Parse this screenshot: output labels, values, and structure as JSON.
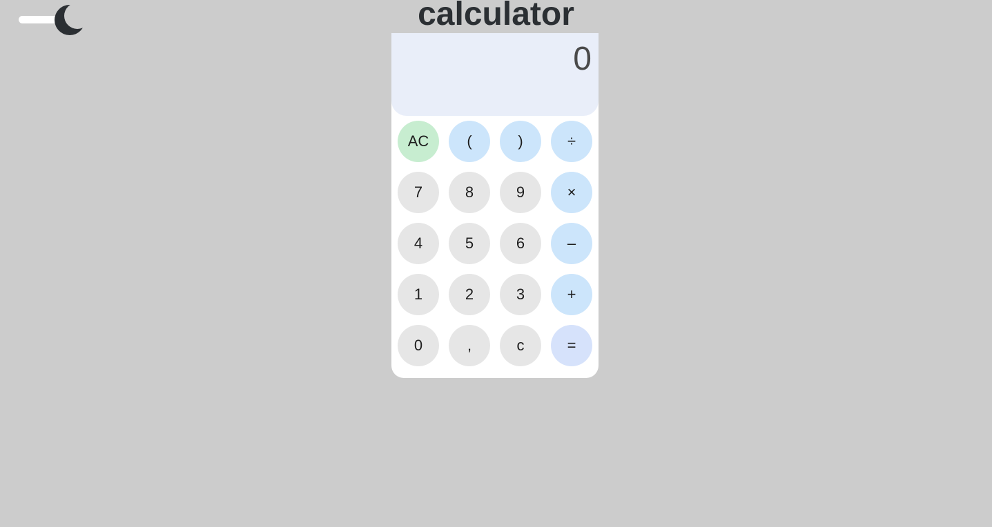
{
  "header": {
    "title": "calculator",
    "theme_toggle_icon": "moon-icon"
  },
  "colors": {
    "background": "#cccccc",
    "display_bg": "#e9eef9",
    "digit_key": "#e6e6e6",
    "operator_key": "#cce5fb",
    "clear_key": "#c7edd0",
    "equals_key": "#d6e2fb"
  },
  "display": {
    "value": "0"
  },
  "keypad": {
    "keys": [
      {
        "label": "AC",
        "type": "clear",
        "name": "all-clear-button"
      },
      {
        "label": "(",
        "type": "op",
        "name": "open-paren-button"
      },
      {
        "label": ")",
        "type": "op",
        "name": "close-paren-button"
      },
      {
        "label": "÷",
        "type": "op",
        "name": "divide-button"
      },
      {
        "label": "7",
        "type": "digit",
        "name": "digit-7-button"
      },
      {
        "label": "8",
        "type": "digit",
        "name": "digit-8-button"
      },
      {
        "label": "9",
        "type": "digit",
        "name": "digit-9-button"
      },
      {
        "label": "×",
        "type": "op",
        "name": "multiply-button"
      },
      {
        "label": "4",
        "type": "digit",
        "name": "digit-4-button"
      },
      {
        "label": "5",
        "type": "digit",
        "name": "digit-5-button"
      },
      {
        "label": "6",
        "type": "digit",
        "name": "digit-6-button"
      },
      {
        "label": "–",
        "type": "op",
        "name": "subtract-button"
      },
      {
        "label": "1",
        "type": "digit",
        "name": "digit-1-button"
      },
      {
        "label": "2",
        "type": "digit",
        "name": "digit-2-button"
      },
      {
        "label": "3",
        "type": "digit",
        "name": "digit-3-button"
      },
      {
        "label": "+",
        "type": "op",
        "name": "add-button"
      },
      {
        "label": "0",
        "type": "digit",
        "name": "digit-0-button"
      },
      {
        "label": ",",
        "type": "digit",
        "name": "decimal-comma-button"
      },
      {
        "label": "c",
        "type": "digit",
        "name": "clear-entry-button"
      },
      {
        "label": "=",
        "type": "equals",
        "name": "equals-button"
      }
    ]
  }
}
